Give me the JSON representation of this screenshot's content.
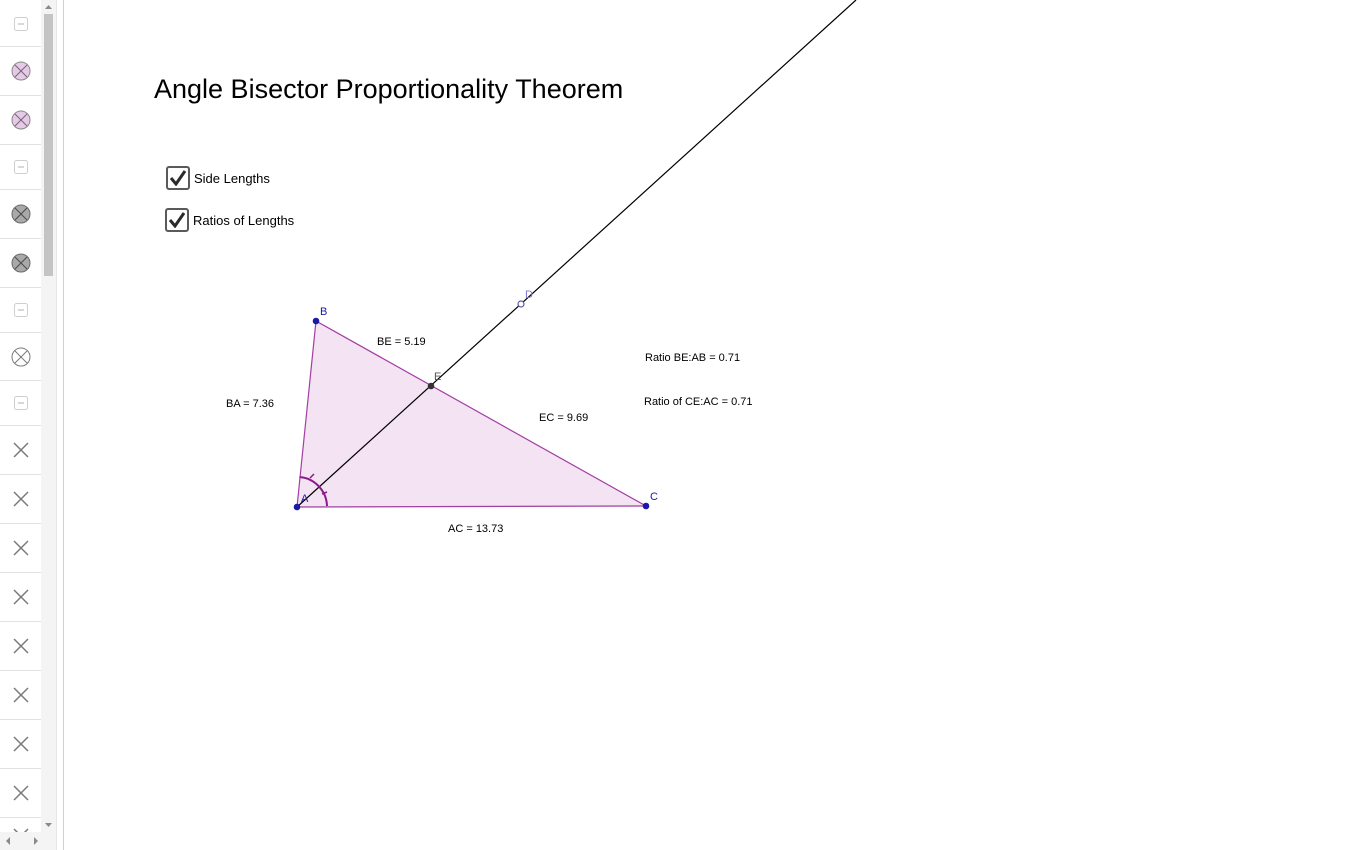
{
  "title": "Angle Bisector Proportionality Theorem",
  "checkboxes": [
    {
      "label": "Side Lengths",
      "checked": true
    },
    {
      "label": "Ratios of Lengths",
      "checked": true
    }
  ],
  "points": {
    "A": "A",
    "B": "B",
    "C": "C",
    "D": "D",
    "E": "E"
  },
  "measurements": {
    "ba": "BA = 7.36",
    "be": "BE = 5.19",
    "ec": "EC = 9.69",
    "ac": "AC = 13.73"
  },
  "ratios": {
    "be_ab": "Ratio BE:AB = 0.71",
    "ce_ac": "Ratio of CE:AC = 0.71"
  },
  "sidebar_icons": [
    "collapse-icon",
    "visibility-icon",
    "visibility-icon",
    "collapse-icon",
    "visibility-icon",
    "visibility-icon",
    "collapse-icon",
    "visibility-icon",
    "collapse-icon",
    "delete-icon",
    "delete-icon",
    "delete-icon",
    "delete-icon",
    "delete-icon",
    "delete-icon",
    "delete-icon",
    "delete-icon"
  ],
  "colors": {
    "triangle_fill": "#f3e3f3",
    "triangle_stroke": "#a23ea2",
    "angle_mark": "#8a1a8a",
    "point": "#1a1aa6",
    "line": "#000000"
  }
}
